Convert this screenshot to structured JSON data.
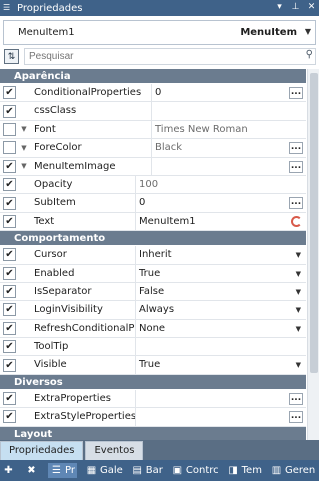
{
  "window": {
    "title": "Propriedades",
    "pin_icon": "pin-icon",
    "close_icon": "close-icon"
  },
  "selector": {
    "name": "MenuItem1",
    "type": "MenuItem"
  },
  "search": {
    "placeholder": "Pesquisar"
  },
  "categories": [
    {
      "label": "Aparência",
      "rows": [
        {
          "name": "ConditionalProperties",
          "value": "0",
          "checked": true,
          "expand": false,
          "indent": false,
          "dim": false,
          "control": "ellipsis"
        },
        {
          "name": "cssClass",
          "value": "",
          "checked": true,
          "expand": false,
          "indent": false,
          "dim": false,
          "control": "none"
        },
        {
          "name": "Font",
          "value": "Times New Roman",
          "checked": false,
          "expand": true,
          "indent": false,
          "dim": true,
          "control": "none"
        },
        {
          "name": "ForeColor",
          "value": "Black",
          "checked": false,
          "expand": true,
          "indent": false,
          "dim": true,
          "control": "ellipsis"
        },
        {
          "name": "MenuItemImage",
          "value": "",
          "checked": true,
          "expand": true,
          "indent": false,
          "dim": false,
          "control": "ellipsis"
        },
        {
          "name": "Opacity",
          "value": "100",
          "checked": true,
          "expand": false,
          "indent": true,
          "dim": true,
          "control": "none"
        },
        {
          "name": "SubItem",
          "value": "0",
          "checked": true,
          "expand": false,
          "indent": true,
          "dim": false,
          "control": "ellipsis"
        },
        {
          "name": "Text",
          "value": "MenuItem1",
          "checked": true,
          "expand": false,
          "indent": true,
          "dim": false,
          "control": "refresh"
        }
      ]
    },
    {
      "label": "Comportamento",
      "rows": [
        {
          "name": "Cursor",
          "value": "Inherit",
          "checked": true,
          "expand": false,
          "indent": true,
          "dim": false,
          "control": "dropdown"
        },
        {
          "name": "Enabled",
          "value": "True",
          "checked": true,
          "expand": false,
          "indent": true,
          "dim": false,
          "control": "dropdown"
        },
        {
          "name": "IsSeparator",
          "value": "False",
          "checked": true,
          "expand": false,
          "indent": true,
          "dim": false,
          "control": "dropdown"
        },
        {
          "name": "LoginVisibility",
          "value": "Always",
          "checked": true,
          "expand": false,
          "indent": true,
          "dim": false,
          "control": "dropdown"
        },
        {
          "name": "RefreshConditionalPropertie",
          "value": "None",
          "checked": true,
          "expand": false,
          "indent": true,
          "dim": false,
          "control": "dropdown"
        },
        {
          "name": "ToolTip",
          "value": "",
          "checked": true,
          "expand": false,
          "indent": true,
          "dim": false,
          "control": "none"
        },
        {
          "name": "Visible",
          "value": "True",
          "checked": true,
          "expand": false,
          "indent": true,
          "dim": false,
          "control": "dropdown"
        }
      ]
    },
    {
      "label": "Diversos",
      "rows": [
        {
          "name": "ExtraProperties",
          "value": "",
          "checked": true,
          "expand": false,
          "indent": true,
          "dim": false,
          "control": "ellipsis"
        },
        {
          "name": "ExtraStyleProperties",
          "value": "",
          "checked": true,
          "expand": false,
          "indent": true,
          "dim": false,
          "control": "ellipsis"
        }
      ]
    },
    {
      "label": "Layout",
      "rows": []
    }
  ],
  "tabs": [
    {
      "label": "Propriedades",
      "active": true
    },
    {
      "label": "Eventos",
      "active": false
    }
  ],
  "taskbar": [
    {
      "label": "",
      "icon": "plus-icon"
    },
    {
      "label": "",
      "icon": "tools-icon"
    },
    {
      "label": "Pr",
      "icon": "properties-icon",
      "active": true
    },
    {
      "label": "Gale",
      "icon": "gallery-icon"
    },
    {
      "label": "Bar",
      "icon": "bar-icon"
    },
    {
      "label": "Contrc",
      "icon": "controls-icon"
    },
    {
      "label": "Tem",
      "icon": "theme-icon"
    },
    {
      "label": "Geren",
      "icon": "manager-icon"
    }
  ],
  "colors": {
    "accent": "#3f6289",
    "category": "#6b7c8f",
    "tab_active": "#c6dff1"
  }
}
